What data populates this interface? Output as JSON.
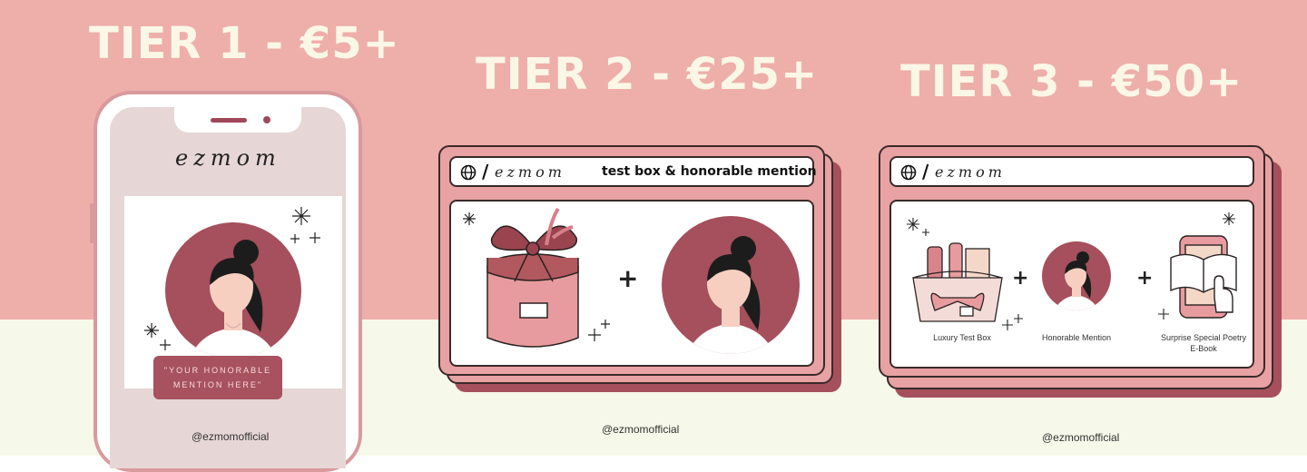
{
  "tiers": [
    {
      "title": "TIER 1 - €5+",
      "handle": "@ezmomofficial",
      "logo": "ezmom",
      "quote": "\"YOUR HONORABLE MENTION HERE\""
    },
    {
      "title": "TIER 2 - €25+",
      "handle": "@ezmomofficial",
      "logo": "ezmom",
      "bar_title": "test box & honorable mention"
    },
    {
      "title": "TIER 3 - €50+",
      "handle": "@ezmomofficial",
      "logo": "ezmom",
      "items": [
        "Luxury Test Box",
        "Honorable Mention",
        "Surprise Special Poetry E-Book"
      ]
    }
  ],
  "plus_sign": "+",
  "colors": {
    "pink_bg": "#eeaeaa",
    "cream_bg": "#f6f8e9",
    "title_text": "#fbf7e6",
    "maroon": "#a5505c"
  }
}
